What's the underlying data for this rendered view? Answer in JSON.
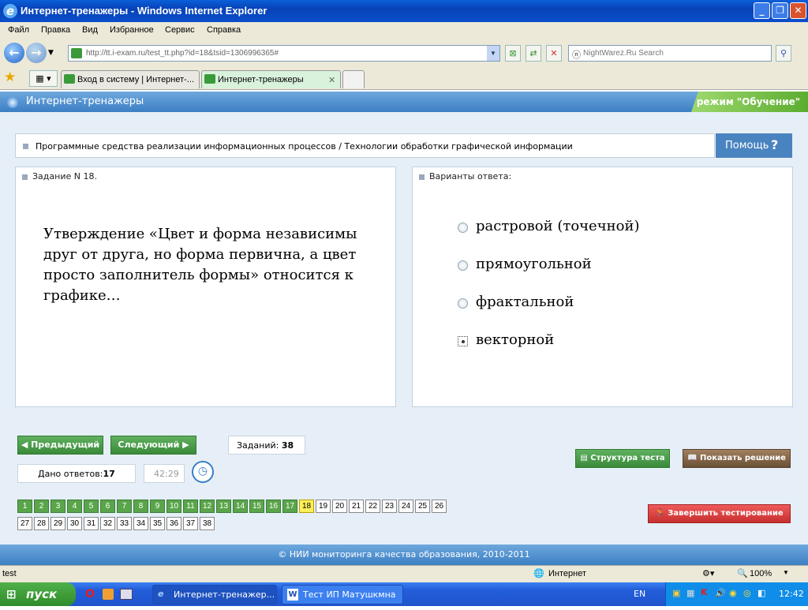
{
  "window": {
    "title": "Интернет-тренажеры - Windows Internet Explorer"
  },
  "menu": [
    "Файл",
    "Правка",
    "Вид",
    "Избранное",
    "Сервис",
    "Справка"
  ],
  "address": {
    "url": "http://tt.i-exam.ru/test_tt.php?id=18&tsid=1306996365#"
  },
  "search": {
    "placeholder": "NightWarez.Ru Search"
  },
  "tabs": [
    {
      "label": "Вход в систему | Интернет-..."
    },
    {
      "label": "Интернет-тренажеры",
      "active": true
    }
  ],
  "app": {
    "title": "Интернет-тренажеры",
    "mode": "режим \"Обучение\""
  },
  "breadcrumb": "Программные средства реализации информационных процессов / Технологии обработки графической информации",
  "help_label": "Помощь",
  "task": {
    "heading": "Задание N 18.",
    "question": "Утверждение «Цвет и форма независимы друг от друга, но форма первична, а цвет просто заполнитель формы» относится к графике…"
  },
  "answers": {
    "heading": "Варианты ответа:",
    "options": [
      {
        "label": "растровой (точечной)",
        "selected": false
      },
      {
        "label": "прямоугольной",
        "selected": false
      },
      {
        "label": "фрактальной",
        "selected": false
      },
      {
        "label": "векторной",
        "selected": true
      }
    ]
  },
  "nav": {
    "prev": "Предыдущий",
    "next": "Следующий",
    "tasks_label": "Заданий:",
    "tasks_count": "38",
    "answered_label": "Дано ответов:",
    "answered_count": "17",
    "timer": "42:29",
    "structure": "Структура теста",
    "show_solution": "Показать решение",
    "finish": "Завершить тестирование"
  },
  "questions": {
    "total": 38,
    "current": 18,
    "answered_upto": 17
  },
  "footer": "© НИИ мониторинга качества образования, 2010-2011",
  "statusbar": {
    "text": "test",
    "zone": "Интернет",
    "zoom": "100%"
  },
  "taskbar": {
    "start": "пуск",
    "items": [
      "Интернет-тренажер...",
      "Тест ИП Матушкмна ..."
    ],
    "lang": "EN",
    "clock": "12:42"
  },
  "colors": {
    "done": "#5aa54a",
    "current": "#ffef5a",
    "header": "#4a84c0",
    "mode": "#5aac2e",
    "finish": "#d94040"
  }
}
